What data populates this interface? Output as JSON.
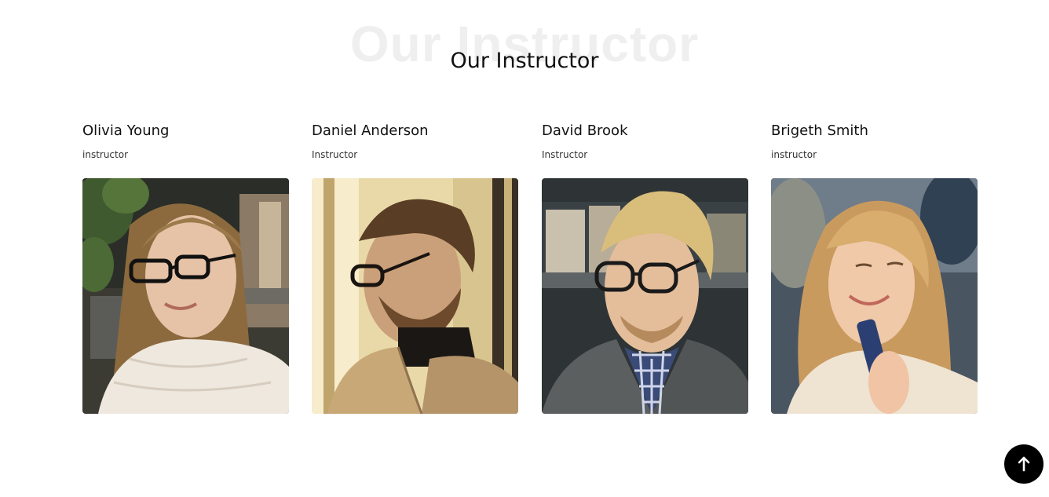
{
  "section": {
    "watermark": "Our Instructor",
    "title": "Our Instructor"
  },
  "instructors": [
    {
      "name": "Olivia Young",
      "role": "instructor"
    },
    {
      "name": "Daniel Anderson",
      "role": "Instructor"
    },
    {
      "name": "David Brook",
      "role": "Instructor"
    },
    {
      "name": "Brigeth Smith",
      "role": "instructor"
    }
  ],
  "scroll_top": {
    "icon": "arrow-up-icon"
  }
}
